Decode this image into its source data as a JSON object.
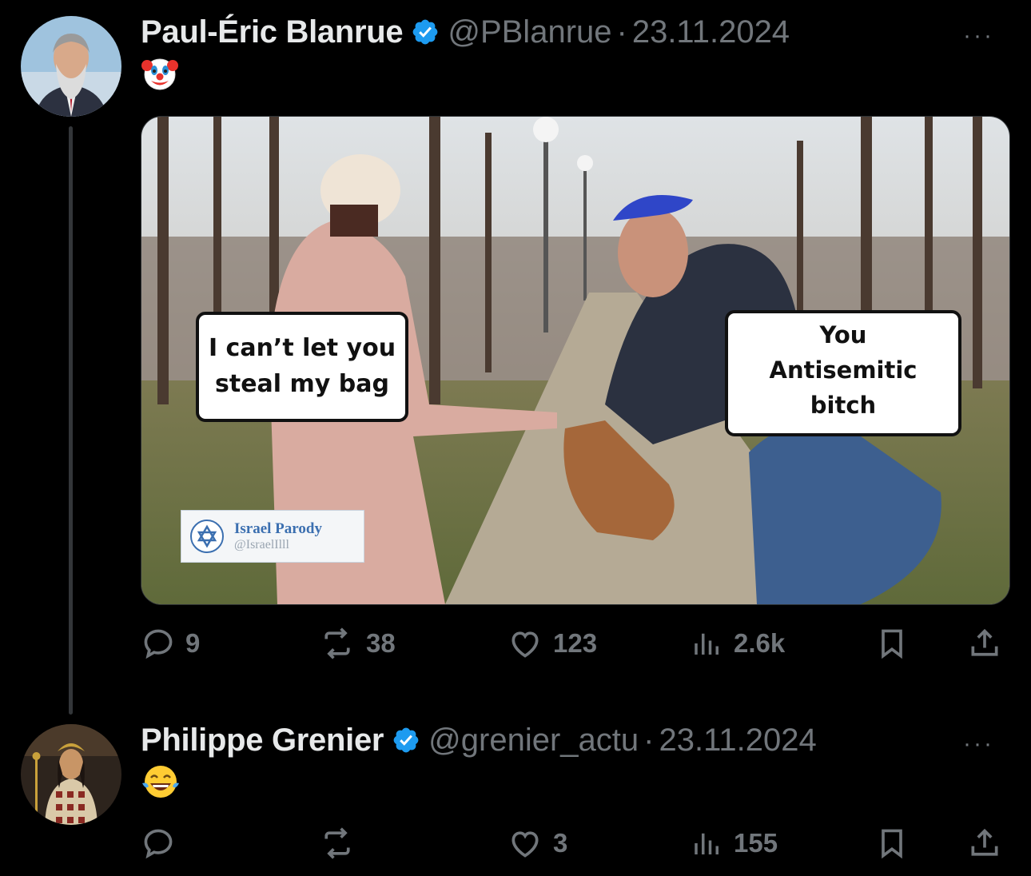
{
  "tweets": [
    {
      "name": "Paul-Éric Blanrue",
      "handle": "@PBlanrue",
      "separator": "·",
      "date": "23.11.2024",
      "more": "···",
      "text_icon": "clown-face-emoji",
      "media": {
        "bubble_left": [
          "I can’t let you",
          "steal my bag"
        ],
        "bubble_right": [
          "You",
          "Antisemitic",
          "bitch"
        ],
        "watermark_title": "Israel Parody",
        "watermark_handle": "@IsraelIlll"
      },
      "stats": {
        "replies": "9",
        "reposts": "38",
        "likes": "123",
        "views": "2.6k"
      }
    },
    {
      "name": "Philippe Grenier",
      "handle": "@grenier_actu",
      "separator": "·",
      "date": "23.11.2024",
      "more": "···",
      "text_icon": "tears-of-joy-emoji",
      "stats": {
        "replies": "",
        "reposts": "",
        "likes": "3",
        "views": "155"
      }
    }
  ],
  "colors": {
    "background": "#000000",
    "text_primary": "#e7e9ea",
    "text_secondary": "#71767b",
    "verified": "#1d9bf0",
    "thread_line": "#333639"
  }
}
